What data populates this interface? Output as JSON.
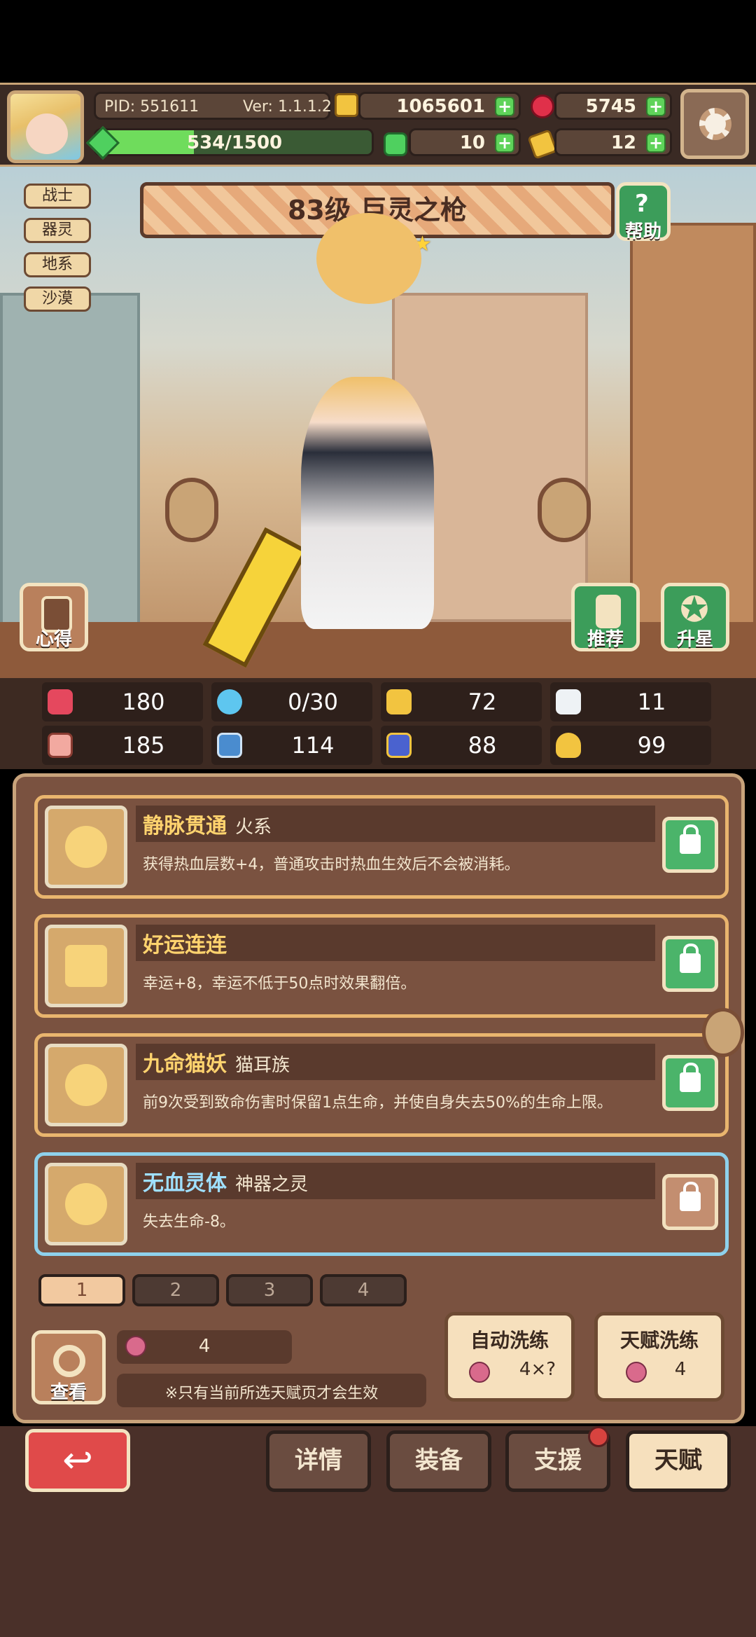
{
  "header": {
    "pid": "PID: 551611",
    "version": "Ver: 1.1.1.2",
    "gold": "1065601",
    "ruby": "5745",
    "energy": "534/1500",
    "energy_fraction": 0.356,
    "clover": "10",
    "key": "12"
  },
  "hero": {
    "tags": [
      "战士",
      "器灵",
      "地系",
      "沙漠"
    ],
    "title": "83级  巨灵之枪",
    "stars": 5,
    "help_label": "帮助",
    "notes_label": "心得",
    "recommend_label": "推荐",
    "star_up_label": "升星"
  },
  "stats": [
    {
      "icon": "heart-icon",
      "value": "180"
    },
    {
      "icon": "water-drop-icon",
      "value": "0/30"
    },
    {
      "icon": "shield-icon",
      "value": "72"
    },
    {
      "icon": "wing-icon",
      "value": "11"
    },
    {
      "icon": "fist-icon",
      "value": "185"
    },
    {
      "icon": "book-icon",
      "value": "114"
    },
    {
      "icon": "boots-icon",
      "value": "88"
    },
    {
      "icon": "horseshoe-icon",
      "value": "99"
    }
  ],
  "talents": [
    {
      "name": "静脉贯通",
      "type": "火系",
      "desc": "获得热血层数+4，普通攻击时热血生效后不会被消耗。",
      "icon": "flame-icon",
      "locked": true,
      "selected": false
    },
    {
      "name": "好运连连",
      "type": "",
      "desc": "幸运+8，幸运不低于50点时效果翻倍。",
      "icon": "clover-cross-icon",
      "locked": true,
      "selected": false
    },
    {
      "name": "九命猫妖",
      "type": "猫耳族",
      "desc": "前9次受到致命伤害时保留1点生命，并使自身失去50%的生命上限。",
      "icon": "cat-icon",
      "locked": true,
      "selected": false
    },
    {
      "name": "无血灵体",
      "type": "神器之灵",
      "desc": "失去生命-8。",
      "icon": "spirit-icon",
      "locked": false,
      "selected": true
    }
  ],
  "pages": [
    "1",
    "2",
    "3",
    "4"
  ],
  "bottom_panel": {
    "view_label": "查看",
    "gem_count": "4",
    "note": "※只有当前所选天赋页才会生效",
    "auto_reroll_label": "自动洗练",
    "auto_reroll_cost": "4×?",
    "talent_reroll_label": "天赋洗练",
    "talent_reroll_cost": "4"
  },
  "nav": {
    "details": "详情",
    "equipment": "装备",
    "support": "支援",
    "talent": "天赋"
  }
}
